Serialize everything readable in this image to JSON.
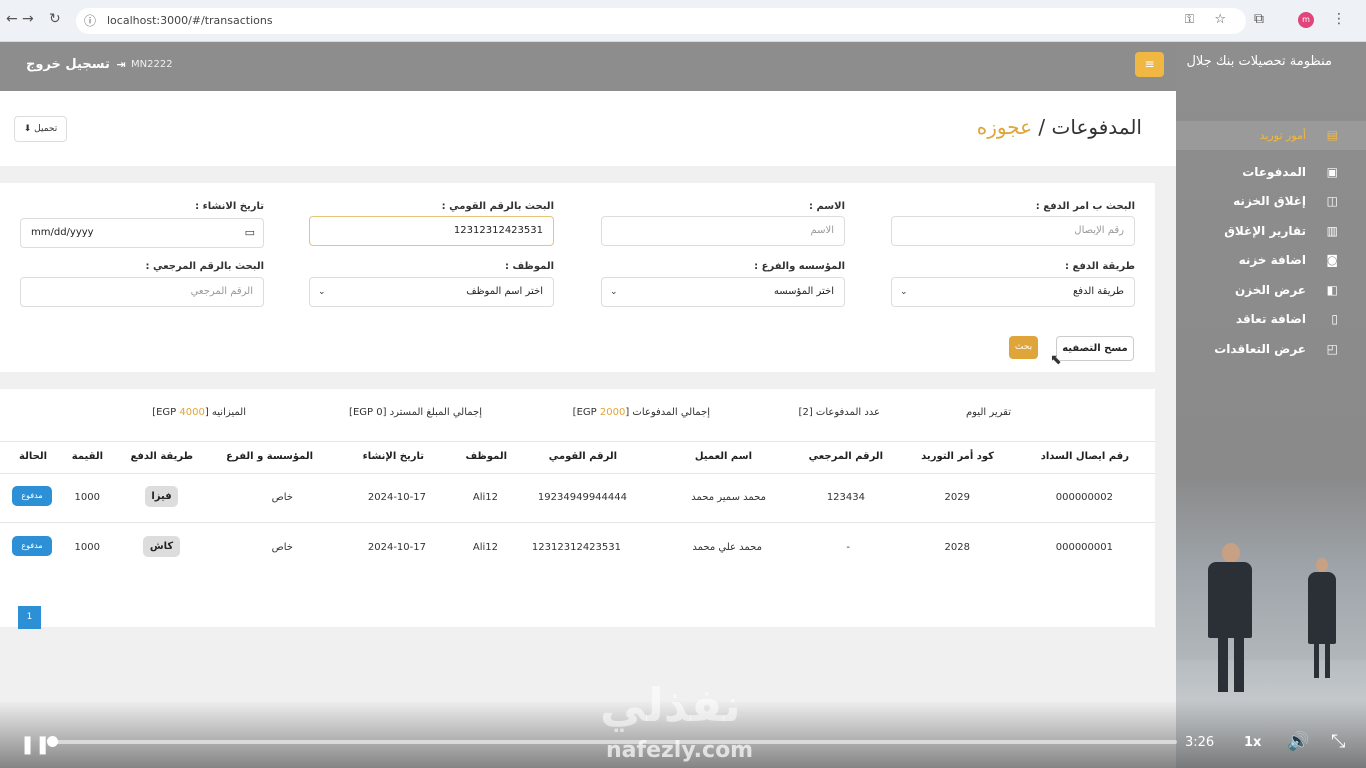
{
  "browser": {
    "url": "localhost:3000/#/transactions",
    "nav_back": "←",
    "nav_forward": "→",
    "nav_reload": "↻",
    "info_icon": "ⓘ",
    "key_icon": "⚿",
    "star_icon": "☆",
    "ext_icon": "⧉",
    "profile_initial": "m",
    "menu_icon": "⋮"
  },
  "header": {
    "logout_label": "تسجيل خروج",
    "logout_icon": "⇥",
    "user_code": "MN2222",
    "menu_icon": "≡"
  },
  "page": {
    "title": "المدفوعات / ",
    "title_accent": "عجوزه",
    "download_label": "تحميل",
    "download_icon": "⬇"
  },
  "filters": {
    "payment_order_label": "البحث ب امر الدفع :",
    "payment_order_placeholder": "رقم الإيصال",
    "name_label": "الاسم :",
    "name_placeholder": "الاسم",
    "national_id_label": "البحث بالرقم القومي :",
    "national_id_value": "12312312423531",
    "created_date_label": "تاريخ الانشاء :",
    "created_date_value": "mm/dd/yyyy",
    "created_date_icon": "▭",
    "payment_method_label": "طريقة الدفع :",
    "payment_method_value": "طريقة الدفع",
    "institution_label": "المؤسسه والفرع :",
    "institution_value": "اختر المؤسسه",
    "employee_label": "الموظف :",
    "employee_value": "اختر اسم الموظف",
    "reference_label": "البحث بالرقم المرجعي :",
    "reference_placeholder": "الرقم المرجعي",
    "caret": "⌄",
    "clear_label": "مسح التصفيه",
    "search_label": "بحث"
  },
  "summary": {
    "today_report": "تقرير اليوم",
    "payments_count_label": "عدد المدفوعات [2]",
    "total_payments_prefix": "إجمالي المدفوعات [",
    "total_payments_value": "2000",
    "total_payments_suffix": " EGP]",
    "refunded_label": "إجمالي المبلغ المسترد [0 EGP]",
    "budget_prefix": "الميزانيه [",
    "budget_value": "4000",
    "budget_suffix": " EGP]"
  },
  "table": {
    "headers": [
      "رقم ايصال السداد",
      "كود أمر التوريد",
      "الرقم المرجعي",
      "اسم العميل",
      "الرقم القومي",
      "الموظف",
      "تاريخ الإنشاء",
      "المؤسسة و الفرع",
      "طريقة الدفع",
      "القيمة",
      "الحالة"
    ],
    "rows": [
      {
        "receipt": "000000002",
        "order_code": "2029",
        "reference": "123434",
        "client": "محمد سمير محمد",
        "national_id": "19234949944444",
        "employee": "Ali12",
        "created": "2024-10-17",
        "institution": "خاص",
        "method": "فيزا",
        "amount": "1000",
        "status": "مدفوع"
      },
      {
        "receipt": "000000001",
        "order_code": "2028",
        "reference": "-",
        "client": "محمد علي محمد",
        "national_id": "12312312423531",
        "employee": "Ali12",
        "created": "2024-10-17",
        "institution": "خاص",
        "method": "كاش",
        "amount": "1000",
        "status": "مدفوع"
      }
    ]
  },
  "pagination": {
    "current": "1"
  },
  "sidebar": {
    "brand": "منظومة تحصيلات بنك جلال",
    "items": [
      {
        "label": "أمور توريد",
        "icon": "▤",
        "active": true
      },
      {
        "label": "المدفوعات",
        "icon": "▣"
      },
      {
        "label": "إغلاق الخزنه",
        "icon": "◫"
      },
      {
        "label": "تقارير الإغلاق",
        "icon": "▥"
      },
      {
        "label": "اضافة خزنه",
        "icon": "◙"
      },
      {
        "label": "عرض الخزن",
        "icon": "◧"
      },
      {
        "label": "اضافة تعاقد",
        "icon": "▯"
      },
      {
        "label": "عرض التعاقدات",
        "icon": "◰"
      }
    ]
  },
  "player": {
    "pause_icon": "❚❚",
    "time": "3:26",
    "speed": "1x",
    "volume_icon": "🔊",
    "fullscreen_icon": "⤡",
    "progress": 0.003,
    "watermark": "نفذلي",
    "watermark_url": "nafezly.com"
  },
  "colors": {
    "accent": "#e0a53a",
    "sidebar_bg": "#8a8a8a",
    "header_bg": "#8d8d8d",
    "status_blue": "#2d8fd5"
  }
}
